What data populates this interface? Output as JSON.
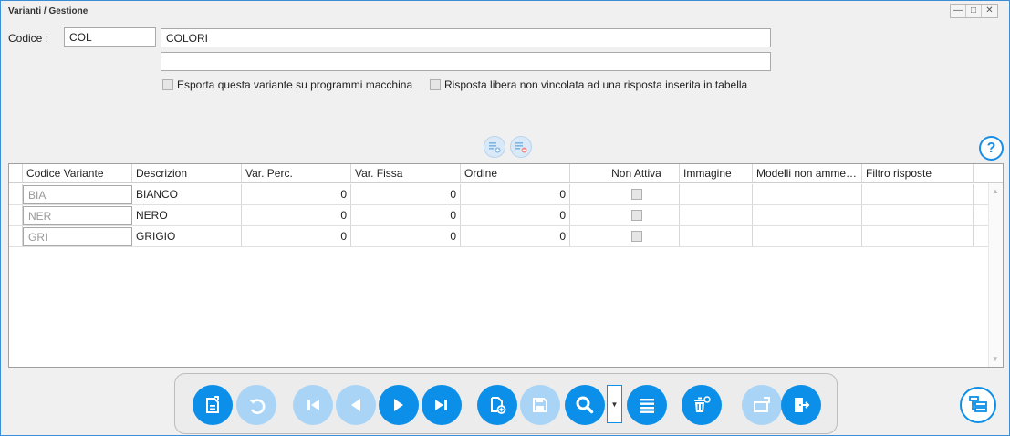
{
  "window": {
    "title": "Varianti / Gestione",
    "controls": [
      "—",
      "□",
      "✕"
    ]
  },
  "form": {
    "codice_label": "Codice :",
    "codice_value": "COL",
    "descrizione_value": "COLORI",
    "descrizione2_value": "",
    "export_label": "Esporta questa variante su programmi macchina",
    "risposta_label": "Risposta libera non vincolata ad una risposta inserita in tabella"
  },
  "help": {
    "label": "?"
  },
  "grid": {
    "headers": [
      "Codice Variante",
      "Descrizion",
      "Var. Perc.",
      "Var. Fissa",
      "Ordine",
      "Non Attiva",
      "Immagine",
      "Modelli non amme…",
      "Filtro risposte"
    ],
    "rows": [
      {
        "codice": "BIA",
        "descrizione": "BIANCO",
        "var_perc": "0",
        "var_fissa": "0",
        "ordine": "0"
      },
      {
        "codice": "NER",
        "descrizione": "NERO",
        "var_perc": "0",
        "var_fissa": "0",
        "ordine": "0"
      },
      {
        "codice": "GRI",
        "descrizione": "GRIGIO",
        "var_perc": "0",
        "var_fissa": "0",
        "ordine": "0"
      }
    ]
  },
  "icons": {
    "add_row": "add-row-icon",
    "remove_row": "remove-row-icon",
    "edit": "edit-document-icon",
    "undo": "undo-icon",
    "first": "first-record-icon",
    "prev": "previous-record-icon",
    "next": "next-record-icon",
    "last": "last-record-icon",
    "new": "new-document-icon",
    "save": "save-icon",
    "search": "search-icon",
    "list": "list-icon",
    "delete": "delete-icon",
    "tags": "tags-icon",
    "exit": "exit-icon",
    "layout": "layout-icon"
  },
  "colors": {
    "accent": "#0b8fe8",
    "accent_disabled": "#a9d4f5",
    "border": "#3c8fd6"
  }
}
